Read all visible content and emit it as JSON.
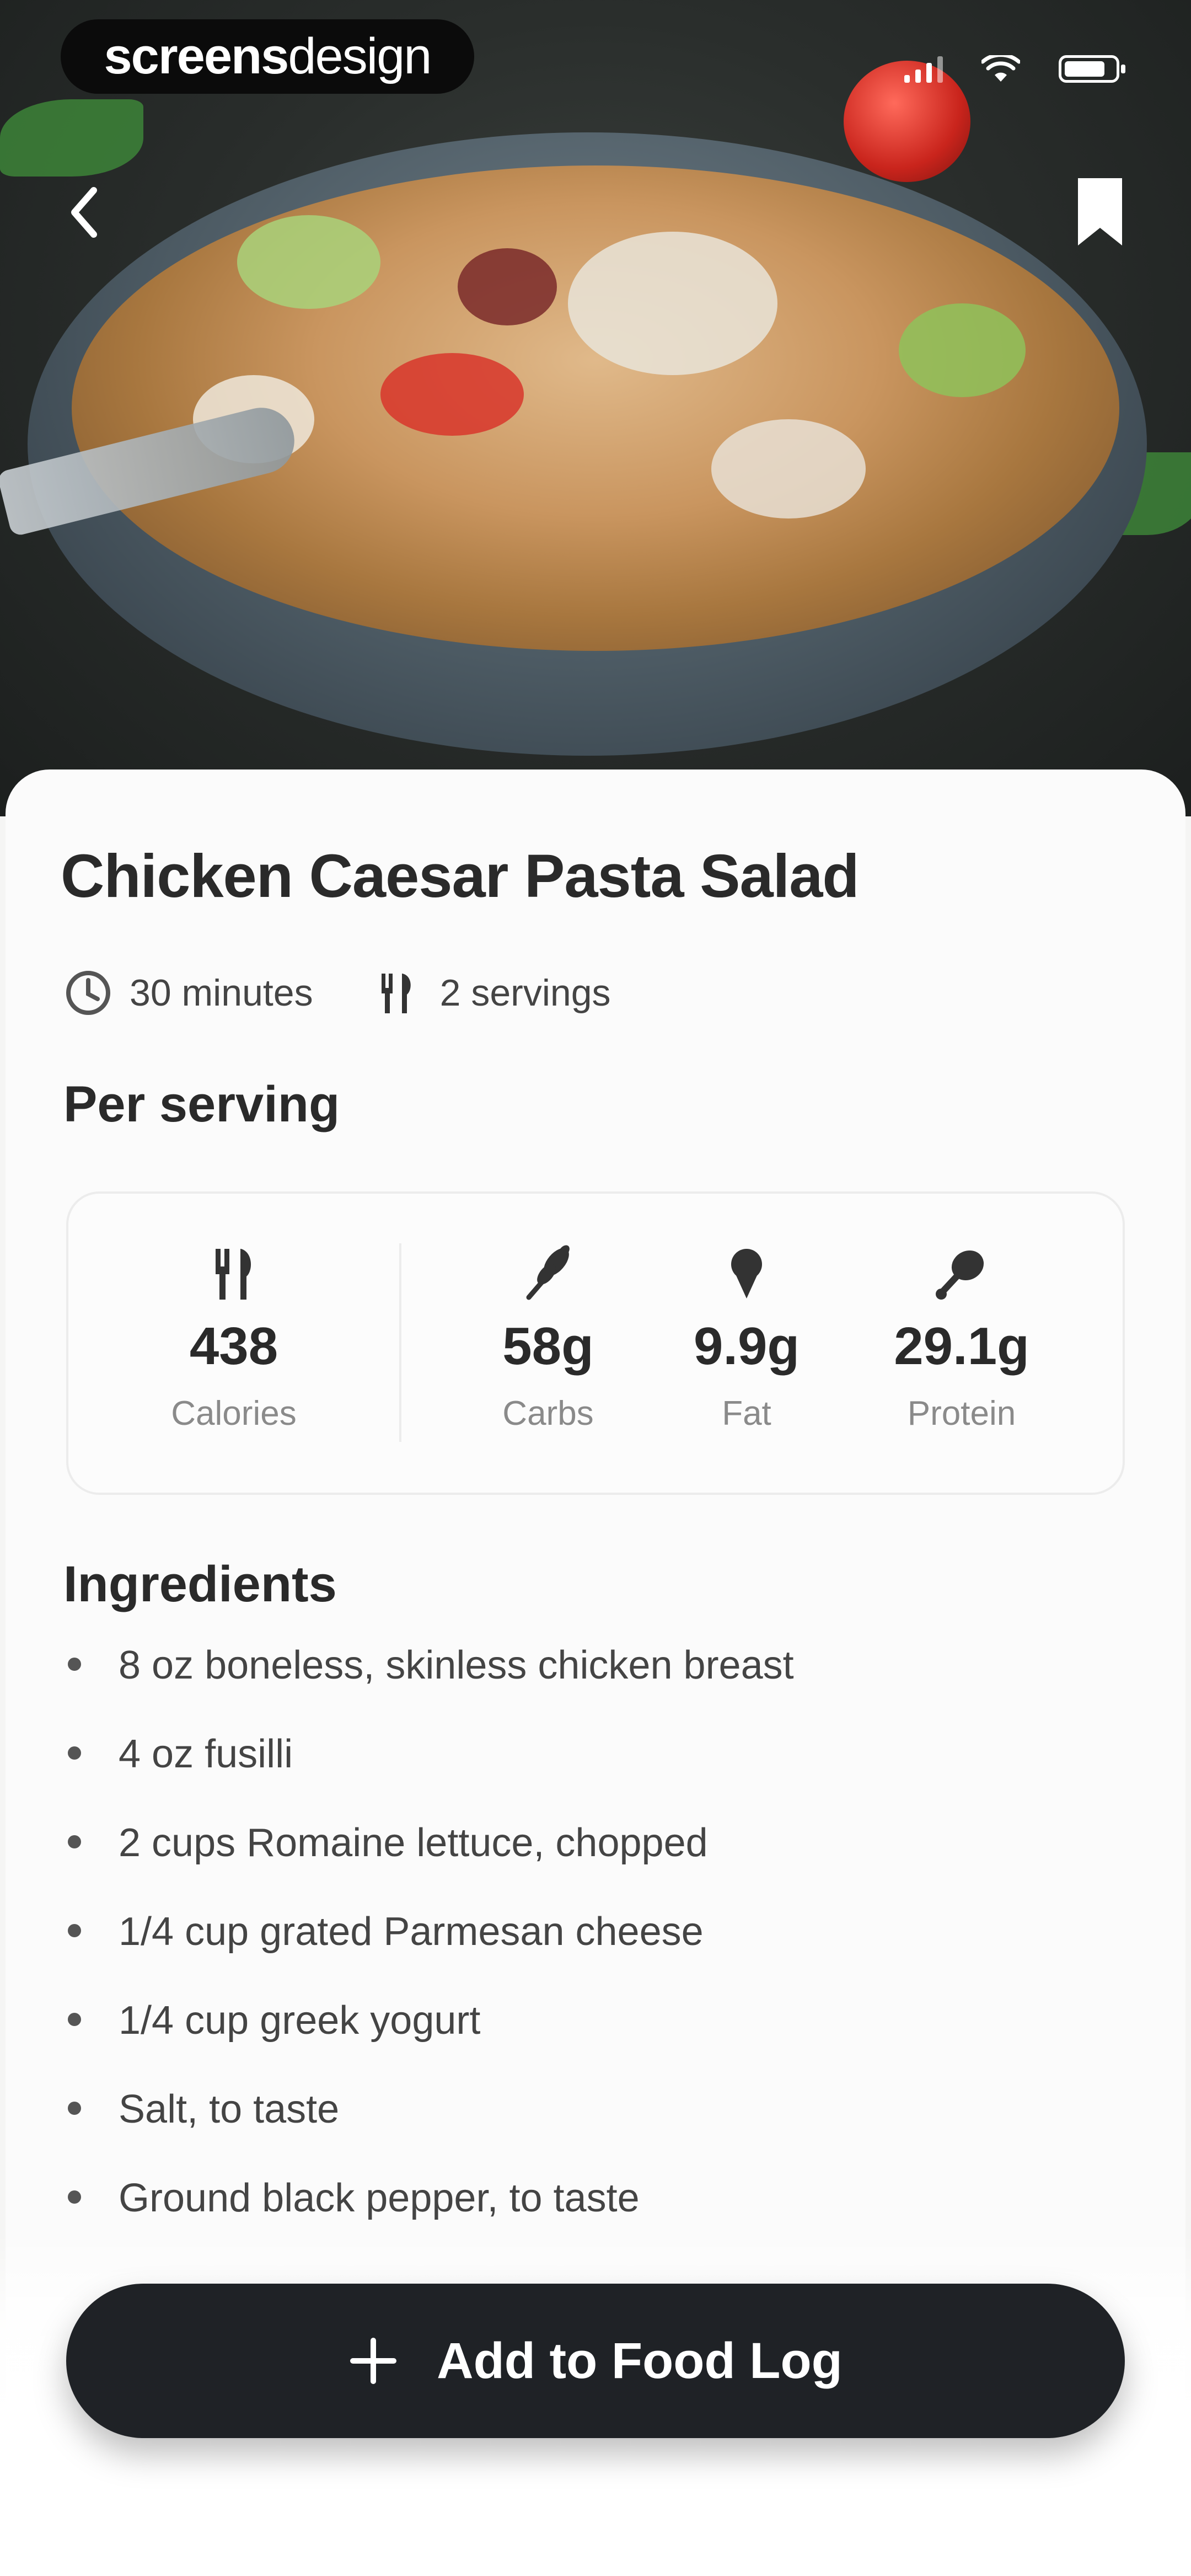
{
  "brand": {
    "bold": "screens",
    "light": "design"
  },
  "recipe": {
    "title": "Chicken Caesar Pasta Salad",
    "time": "30 minutes",
    "servings": "2 servings"
  },
  "nutrition": {
    "heading": "Per serving",
    "items": [
      {
        "value": "438",
        "label": "Calories",
        "icon": "utensils-icon"
      },
      {
        "value": "58g",
        "label": "Carbs",
        "icon": "wheat-icon"
      },
      {
        "value": "9.9g",
        "label": "Fat",
        "icon": "ice-cream-icon"
      },
      {
        "value": "29.1g",
        "label": "Protein",
        "icon": "drumstick-icon"
      }
    ]
  },
  "ingredients": {
    "heading": "Ingredients",
    "items": [
      "8 oz boneless, skinless chicken breast",
      "4 oz fusilli",
      "2 cups Romaine lettuce, chopped",
      "1/4 cup grated Parmesan cheese",
      "1/4 cup greek yogurt",
      "Salt, to taste",
      "Ground black pepper, to taste"
    ]
  },
  "cta": {
    "label": "Add to Food Log"
  },
  "colors": {
    "button_bg": "#1f2226",
    "sheet_bg": "#fbfbfb",
    "text_primary": "#2a2a2a",
    "text_muted": "#8a8a8a"
  }
}
